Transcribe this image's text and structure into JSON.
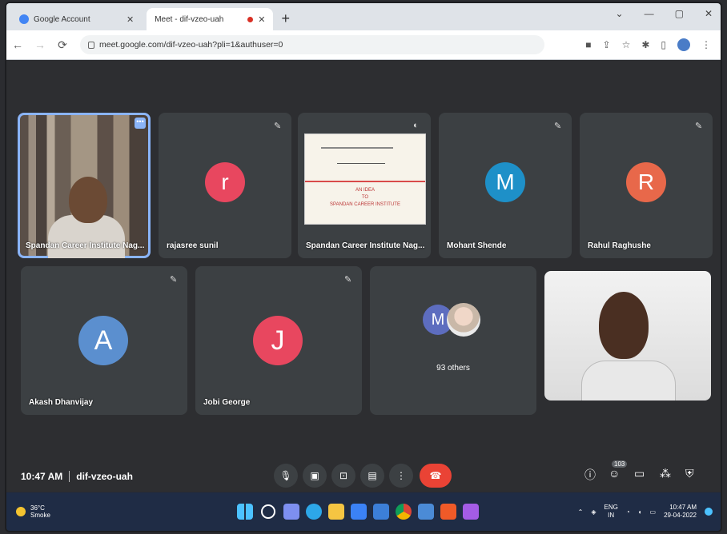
{
  "browser": {
    "tabs": [
      {
        "title": "Google Account",
        "active": false
      },
      {
        "title": "Meet - dif-vzeo-uah",
        "active": true
      }
    ],
    "new_tab": "+",
    "url": "meet.google.com/dif-vzeo-uah?pli=1&authuser=0"
  },
  "participants_row1": [
    {
      "name": "Spandan Career Institute Nag...",
      "kind": "video",
      "highlight": true
    },
    {
      "name": "rajasree sunil",
      "initial": "r",
      "color": "#e8475f"
    },
    {
      "name": "Spandan Career Institute Nag...",
      "kind": "screen"
    },
    {
      "name": "Mohant Shende",
      "initial": "M",
      "color": "#1e90c8"
    },
    {
      "name": "Rahul Raghushe",
      "initial": "R",
      "color": "#e8684a"
    }
  ],
  "participants_row2": [
    {
      "name": "Akash Dhanvijay",
      "initial": "A",
      "color": "#5b8fcf"
    },
    {
      "name": "Jobi George",
      "initial": "J",
      "color": "#e8475f"
    },
    {
      "name": "93 others",
      "initial": "M",
      "color": "#5d6dbf"
    },
    {
      "name": "",
      "kind": "self-video"
    }
  ],
  "slide": {
    "lines": [
      "AN IDEA",
      "TO",
      "SPANDAN CAREER INSTITUTE"
    ]
  },
  "meeting": {
    "time": "10:47 AM",
    "code": "dif-vzeo-uah"
  },
  "controls": {
    "people_count": "103"
  },
  "taskbar": {
    "weather_temp": "36°C",
    "weather_desc": "Smoke",
    "lang": "ENG",
    "lang_region": "IN",
    "time": "10:47 AM",
    "date": "29-04-2022"
  }
}
